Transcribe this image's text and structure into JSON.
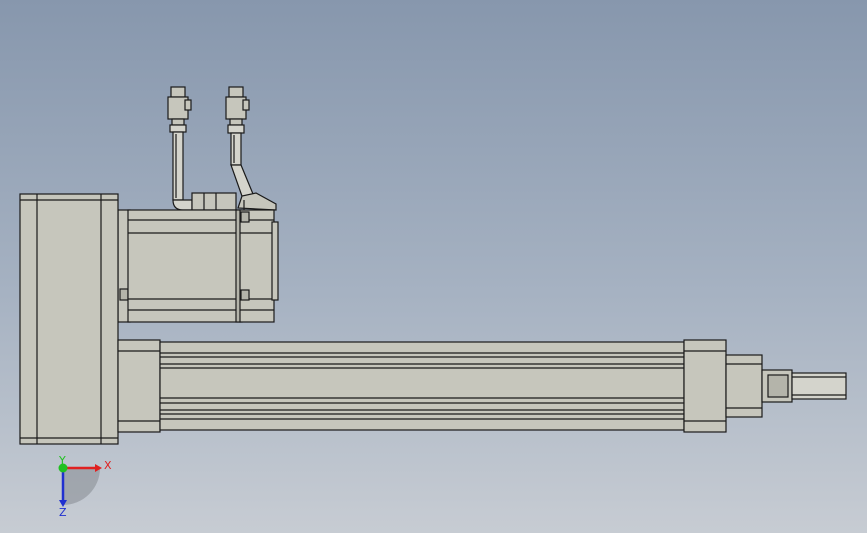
{
  "triad": {
    "x_label": "X",
    "y_label": "Y",
    "z_label": "Z",
    "x_color": "#e02020",
    "y_color": "#20c020",
    "z_color": "#2030d0"
  },
  "colors": {
    "part_fill": "#c6c6bc",
    "part_shade": "#b4b4aa",
    "edge": "#1a1a1a"
  }
}
